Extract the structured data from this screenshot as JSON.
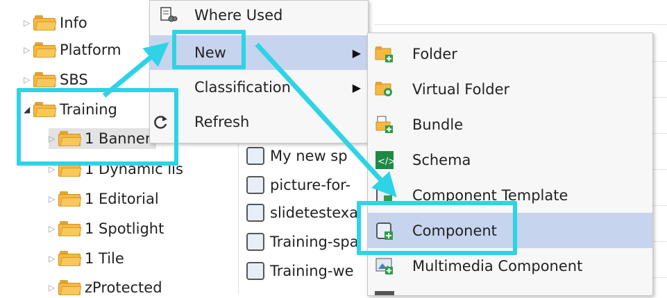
{
  "tree": {
    "items": [
      {
        "label": "Info"
      },
      {
        "label": "Platform"
      },
      {
        "label": "SBS"
      },
      {
        "label": "Training"
      },
      {
        "label": "1 Banner"
      },
      {
        "label": "1 Dynamic lis"
      },
      {
        "label": "1 Editorial"
      },
      {
        "label": "1 Spotlight"
      },
      {
        "label": "1 Tile"
      },
      {
        "label": "zProtected"
      }
    ]
  },
  "list": {
    "items": [
      {
        "label": "My new sp"
      },
      {
        "label": "picture-for-"
      },
      {
        "label": "slidetestexa"
      },
      {
        "label": "Training-spa"
      },
      {
        "label": "Training-we"
      }
    ]
  },
  "context_menu": {
    "items": [
      {
        "label": "Where Used",
        "icon": "where-used-icon"
      },
      {
        "label": "New",
        "icon": "",
        "submenu": true
      },
      {
        "label": "Classification",
        "icon": "",
        "submenu": true
      },
      {
        "label": "Refresh",
        "icon": "refresh-icon"
      }
    ]
  },
  "submenu": {
    "items": [
      {
        "label": "Folder",
        "icon": "folder-add-icon"
      },
      {
        "label": "Virtual Folder",
        "icon": "virtual-folder-icon"
      },
      {
        "label": "Bundle",
        "icon": "bundle-icon"
      },
      {
        "label": "Schema",
        "icon": "schema-icon"
      },
      {
        "label": "Component Template",
        "icon": "component-template-icon"
      },
      {
        "label": "Component",
        "icon": "component-add-icon"
      },
      {
        "label": "Multimedia Component",
        "icon": "multimedia-component-icon"
      }
    ]
  },
  "colors": {
    "highlight_box": "#2ed3e6",
    "menu_selection": "#c7d4ee",
    "folder": "#f5b942"
  }
}
